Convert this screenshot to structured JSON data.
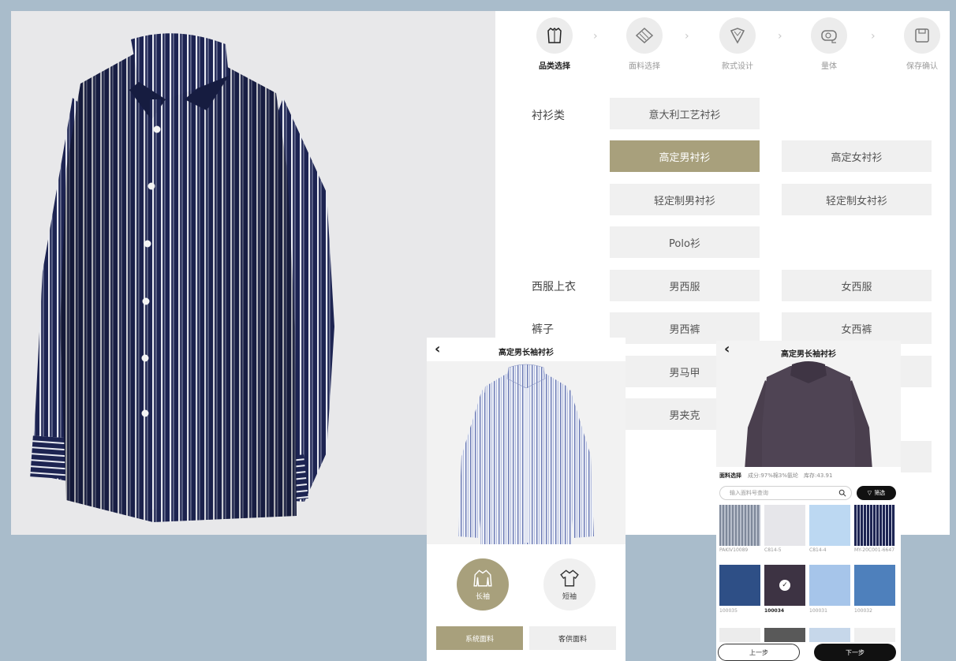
{
  "steps": [
    {
      "label": "品类选择",
      "icon": "shirt-icon",
      "active": true
    },
    {
      "label": "面料选择",
      "icon": "fabric-icon",
      "active": false
    },
    {
      "label": "款式设计",
      "icon": "collar-icon",
      "active": false
    },
    {
      "label": "量体",
      "icon": "tape-measure-icon",
      "active": false
    },
    {
      "label": "保存确认",
      "icon": "save-icon",
      "active": false
    }
  ],
  "categories": {
    "shirts": {
      "label": "衬衫类",
      "options": [
        "意大利工艺衬衫",
        "高定男衬衫",
        "高定女衬衫",
        "轻定制男衬衫",
        "轻定制女衬衫",
        "Polo衫"
      ]
    },
    "suit_tops": {
      "label": "西服上衣",
      "options": [
        "男西服",
        "女西服"
      ]
    },
    "trousers": {
      "label": "裤子",
      "options": [
        "男西裤",
        "女西裤"
      ]
    },
    "others": {
      "options": [
        "男马甲",
        "男夹克"
      ]
    }
  },
  "selected_option": "高定男衬衫",
  "phone1": {
    "title": "高定男长袖衬衫",
    "sleeve_long": "长袖",
    "sleeve_short": "短袖",
    "btn_system": "系统面料",
    "btn_customer": "客供面料"
  },
  "phone2": {
    "title": "高定男长袖衬衫",
    "fabric_title": "面料选择",
    "fabric_info": "成分:97%棉3%氨纶　库存:43.91",
    "search_placeholder": "输入面料号查询",
    "filter_label": "筛选",
    "swatches": [
      {
        "code": "PAKIV10089",
        "color": "#8e98a8",
        "pattern": "stripe-light"
      },
      {
        "code": "C814-5",
        "color": "#e6e6ea",
        "pattern": "plain"
      },
      {
        "code": "C814-4",
        "color": "#bcd8f2",
        "pattern": "plain"
      },
      {
        "code": "MY-20C001-6647",
        "color": "#1d2452",
        "pattern": "stripe-dark"
      },
      {
        "code": "100035",
        "color": "#2e4f86",
        "pattern": "plain"
      },
      {
        "code": "100034",
        "color": "#3d3343",
        "pattern": "plain",
        "selected": true
      },
      {
        "code": "100031",
        "color": "#a6c5ea",
        "pattern": "plain"
      },
      {
        "code": "100032",
        "color": "#4e80bc",
        "pattern": "plain"
      }
    ],
    "prev_label": "上一步",
    "next_label": "下一步"
  },
  "colors": {
    "accent": "#a8a07c",
    "navy": "#1d2452",
    "background": "#a9bccb"
  }
}
